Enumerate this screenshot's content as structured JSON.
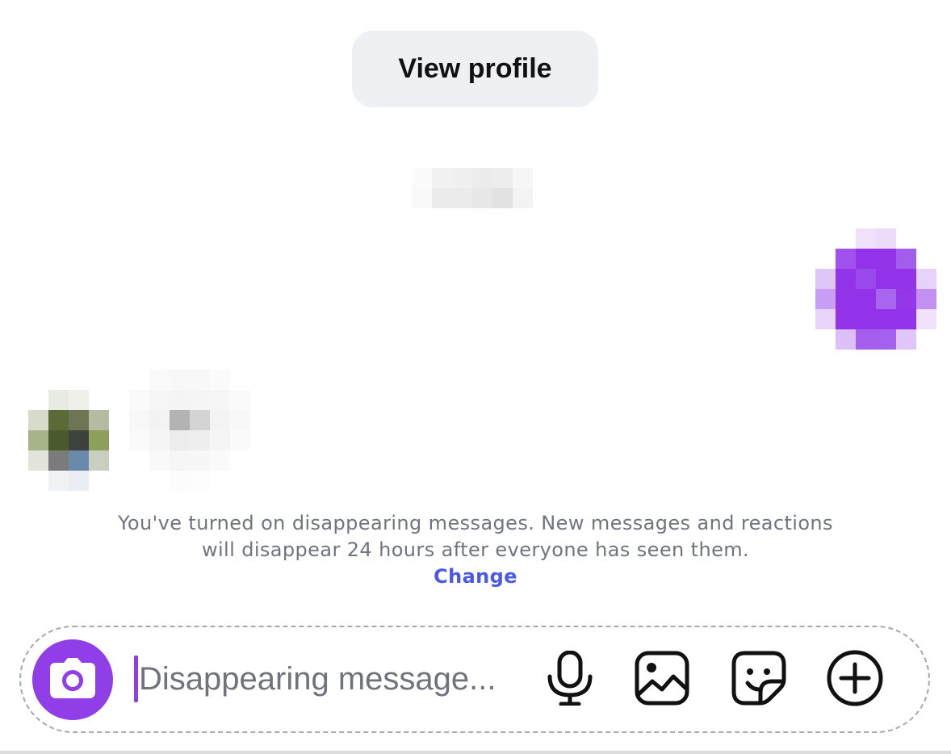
{
  "header": {
    "view_profile_label": "View profile"
  },
  "notice": {
    "text": "You've turned on disappearing messages. New messages and reactions will disappear 24 hours after everyone has seen them.",
    "change_label": "Change"
  },
  "composer": {
    "placeholder": "Disappearing message...",
    "value": "",
    "icons": {
      "camera": "camera-icon",
      "mic": "microphone-icon",
      "gallery": "image-gallery-icon",
      "sticker": "sticker-icon",
      "more": "plus-circle-icon"
    }
  },
  "colors": {
    "accent": "#8f3ee8",
    "link": "#4a5ae6",
    "notice_text": "#6f7480",
    "button_bg": "#eff0f4"
  }
}
